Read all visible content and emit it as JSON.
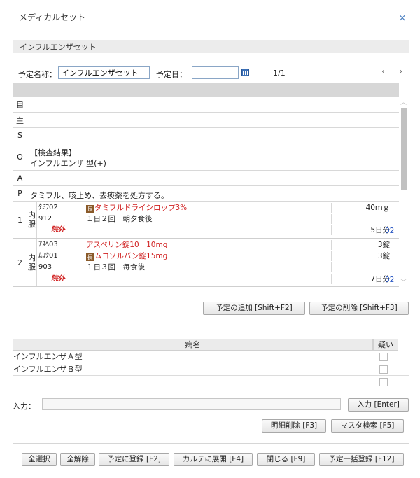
{
  "window": {
    "title": "メディカルセット",
    "close": "×"
  },
  "section": {
    "title": "インフルエンザセット"
  },
  "form": {
    "name_label": "予定名称：",
    "name_value": "インフルエンザセット",
    "date_label": "予定日：",
    "date_value": "",
    "page": "1/1",
    "prev": "‹",
    "next": "›"
  },
  "soap": {
    "rows": [
      {
        "key": "自",
        "text": ""
      },
      {
        "key": "主",
        "text": ""
      },
      {
        "key": "S",
        "text": ""
      },
      {
        "key": "O",
        "text": "【検査結果】",
        "text2": "インフルエンザ 型(+)"
      },
      {
        "key": "A",
        "text": ""
      },
      {
        "key": "P",
        "text": "タミフル、咳止め、去痰薬を処方する。"
      }
    ]
  },
  "prescriptions": [
    {
      "num": "1",
      "kind_a": "内",
      "kind_b": "服",
      "lines": [
        {
          "code": "ﾀﾐﾌ02",
          "badge": "長",
          "drug": "タミフルドライシロップ3%",
          "qty": "40ｍｇ",
          "style": "red"
        },
        {
          "code": "912",
          "drug": "１日２回　朝夕食後",
          "style": "normal"
        },
        {
          "code": "",
          "drug": "院外",
          "qty": "5日分",
          "extra": "02",
          "style": "outside"
        }
      ]
    },
    {
      "num": "2",
      "kind_a": "内",
      "kind_b": "服",
      "lines": [
        {
          "code": "ｱｽﾍ03",
          "drug": "アスベリン錠10　10mg",
          "qty": "3錠",
          "style": "red"
        },
        {
          "code": "ﾑｺﾂ01",
          "badge": "長",
          "drug": "ムコソルバン錠15mg",
          "qty": "3錠",
          "style": "red"
        },
        {
          "code": "903",
          "drug": "１日３回　毎食後",
          "style": "normal"
        },
        {
          "code": "",
          "drug": "院外",
          "qty": "7日分",
          "extra": "02",
          "style": "outside"
        }
      ]
    }
  ],
  "buttons": {
    "add_plan": "予定の追加 [Shift+F2]",
    "delete_plan": "予定の削除 [Shift+F3]",
    "input": "入力 [Enter]",
    "detail_delete": "明細削除 [F3]",
    "master_search": "マスタ検索 [F5]",
    "select_all": "全選択",
    "deselect_all": "全解除",
    "register_plan": "予定に登録 [F2]",
    "expand_karte": "カルテに展開 [F4]",
    "close": "閉じる [F9]",
    "bulk_register": "予定一括登録 [F12]"
  },
  "disease_table": {
    "headers": {
      "name": "病名",
      "suspect": "疑い"
    },
    "rows": [
      {
        "name": "インフルエンザＡ型"
      },
      {
        "name": "インフルエンザＢ型"
      },
      {
        "name": ""
      }
    ]
  },
  "input_row": {
    "label": "入力：",
    "value": ""
  },
  "colors": {
    "accent": "#3b6fb6",
    "red_text": "#d02020",
    "blue_text": "#2050c0"
  }
}
